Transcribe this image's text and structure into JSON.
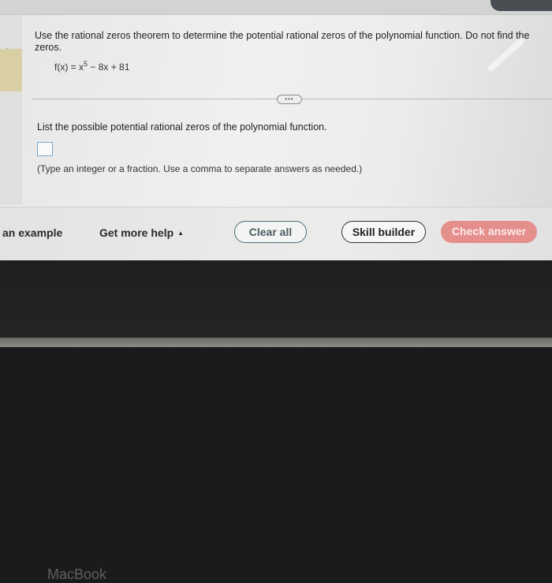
{
  "question": {
    "line1": "Use the rational zeros theorem to determine the potential rational zeros of the polynomial function. Do not find the",
    "line2": "zeros."
  },
  "equation": {
    "lhs": "f(x) = x",
    "exponent": "5",
    "rhs": " − 8x + 81"
  },
  "divider_button": "•••",
  "prompt": "List the possible potential rational zeros of the polynomial function.",
  "answer": {
    "value": ""
  },
  "hint": "(Type an integer or a fraction. Use a comma to separate answers as needed.)",
  "footer": {
    "example_link": "an example",
    "help_link": "Get more help",
    "help_caret": "▲",
    "clear_button": "Clear all",
    "skill_button": "Skill builder",
    "check_button": "Check answer"
  },
  "device_label": "MacBook",
  "colors": {
    "check_button": "#e58f8d",
    "answer_box_border": "#7aa6c8",
    "clear_button_border": "#4a6d78"
  }
}
